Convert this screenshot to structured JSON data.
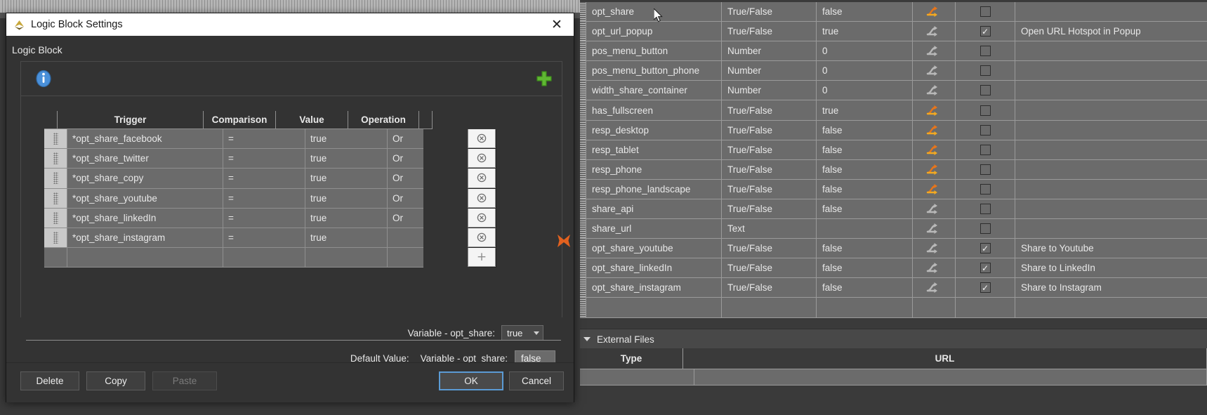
{
  "dialog": {
    "title": "Logic Block Settings",
    "close_label": "✕",
    "section_label": "Logic Block",
    "table": {
      "columns": [
        "Trigger",
        "Comparison",
        "Value",
        "Operation"
      ],
      "rows": [
        {
          "trigger": "*opt_share_facebook",
          "comparison": "=",
          "value": "true",
          "operation": "Or"
        },
        {
          "trigger": "*opt_share_twitter",
          "comparison": "=",
          "value": "true",
          "operation": "Or"
        },
        {
          "trigger": "*opt_share_copy",
          "comparison": "=",
          "value": "true",
          "operation": "Or"
        },
        {
          "trigger": "*opt_share_youtube",
          "comparison": "=",
          "value": "true",
          "operation": "Or"
        },
        {
          "trigger": "*opt_share_linkedIn",
          "comparison": "=",
          "value": "true",
          "operation": "Or"
        },
        {
          "trigger": "*opt_share_instagram",
          "comparison": "=",
          "value": "true",
          "operation": ""
        }
      ],
      "add_row_label": "+"
    },
    "variable_line": {
      "label": "Variable - opt_share:",
      "value": "true"
    },
    "default_line": {
      "prefix": "Default Value:",
      "label": "Variable - opt_share:",
      "value": "false"
    },
    "buttons": {
      "delete": "Delete",
      "copy": "Copy",
      "paste": "Paste",
      "ok": "OK",
      "cancel": "Cancel"
    }
  },
  "variables_panel": {
    "rows": [
      {
        "name": "opt_share",
        "type": "True/False",
        "value": "false",
        "fork": "active",
        "checked": false,
        "description": ""
      },
      {
        "name": "opt_url_popup",
        "type": "True/False",
        "value": "true",
        "fork": "inactive",
        "checked": true,
        "description": "Open URL Hotspot in Popup"
      },
      {
        "name": "pos_menu_button",
        "type": "Number",
        "value": "0",
        "fork": "inactive",
        "checked": false,
        "description": ""
      },
      {
        "name": "pos_menu_button_phone",
        "type": "Number",
        "value": "0",
        "fork": "inactive",
        "checked": false,
        "description": ""
      },
      {
        "name": "width_share_container",
        "type": "Number",
        "value": "0",
        "fork": "inactive",
        "checked": false,
        "description": ""
      },
      {
        "name": "has_fullscreen",
        "type": "True/False",
        "value": "true",
        "fork": "active",
        "checked": false,
        "description": ""
      },
      {
        "name": "resp_desktop",
        "type": "True/False",
        "value": "false",
        "fork": "active",
        "checked": false,
        "description": ""
      },
      {
        "name": "resp_tablet",
        "type": "True/False",
        "value": "false",
        "fork": "active",
        "checked": false,
        "description": ""
      },
      {
        "name": "resp_phone",
        "type": "True/False",
        "value": "false",
        "fork": "active",
        "checked": false,
        "description": ""
      },
      {
        "name": "resp_phone_landscape",
        "type": "True/False",
        "value": "false",
        "fork": "active",
        "checked": false,
        "description": ""
      },
      {
        "name": "share_api",
        "type": "True/False",
        "value": "false",
        "fork": "inactive",
        "checked": false,
        "description": ""
      },
      {
        "name": "share_url",
        "type": "Text",
        "value": "",
        "fork": "inactive",
        "checked": false,
        "description": ""
      },
      {
        "name": "opt_share_youtube",
        "type": "True/False",
        "value": "false",
        "fork": "inactive",
        "checked": true,
        "description": "Share to Youtube"
      },
      {
        "name": "opt_share_linkedIn",
        "type": "True/False",
        "value": "false",
        "fork": "inactive",
        "checked": true,
        "description": "Share to LinkedIn"
      },
      {
        "name": "opt_share_instagram",
        "type": "True/False",
        "value": "false",
        "fork": "inactive",
        "checked": true,
        "description": "Share to Instagram"
      },
      {
        "name": "",
        "type": "",
        "value": "",
        "fork": "none",
        "checked": null,
        "description": ""
      }
    ],
    "checkmark": "✓"
  },
  "external_files": {
    "section_label": "External Files",
    "columns": [
      "Type",
      "URL"
    ]
  },
  "colors": {
    "fork_active_top": "#e8751a",
    "fork_active_bottom": "#f2a922",
    "fork_inactive": "#b8b8b8",
    "accent_blue": "#5b9bd5",
    "delete_x": "#e2611f",
    "info_blue": "#4a90d9",
    "plus_green": "#5fb832"
  }
}
